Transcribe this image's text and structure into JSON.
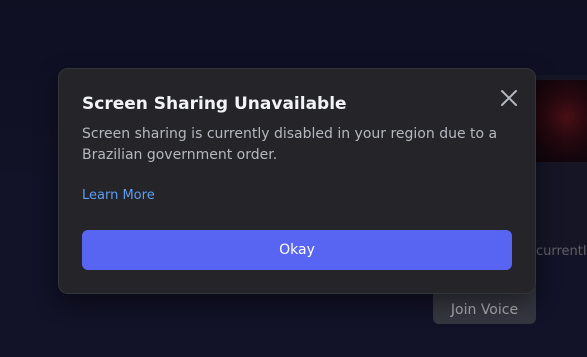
{
  "background": {
    "partial_text": "currently",
    "join_voice_label": "Join Voice"
  },
  "modal": {
    "title": "Screen Sharing Unavailable",
    "body": "Screen sharing is currently disabled in your region due to a Brazilian government order.",
    "learn_more_label": "Learn More",
    "okay_label": "Okay",
    "close_icon": "close-icon"
  },
  "colors": {
    "primary_button": "#5865f2",
    "link": "#5d9ef0",
    "modal_bg": "#242429",
    "page_bg": "#161630"
  }
}
